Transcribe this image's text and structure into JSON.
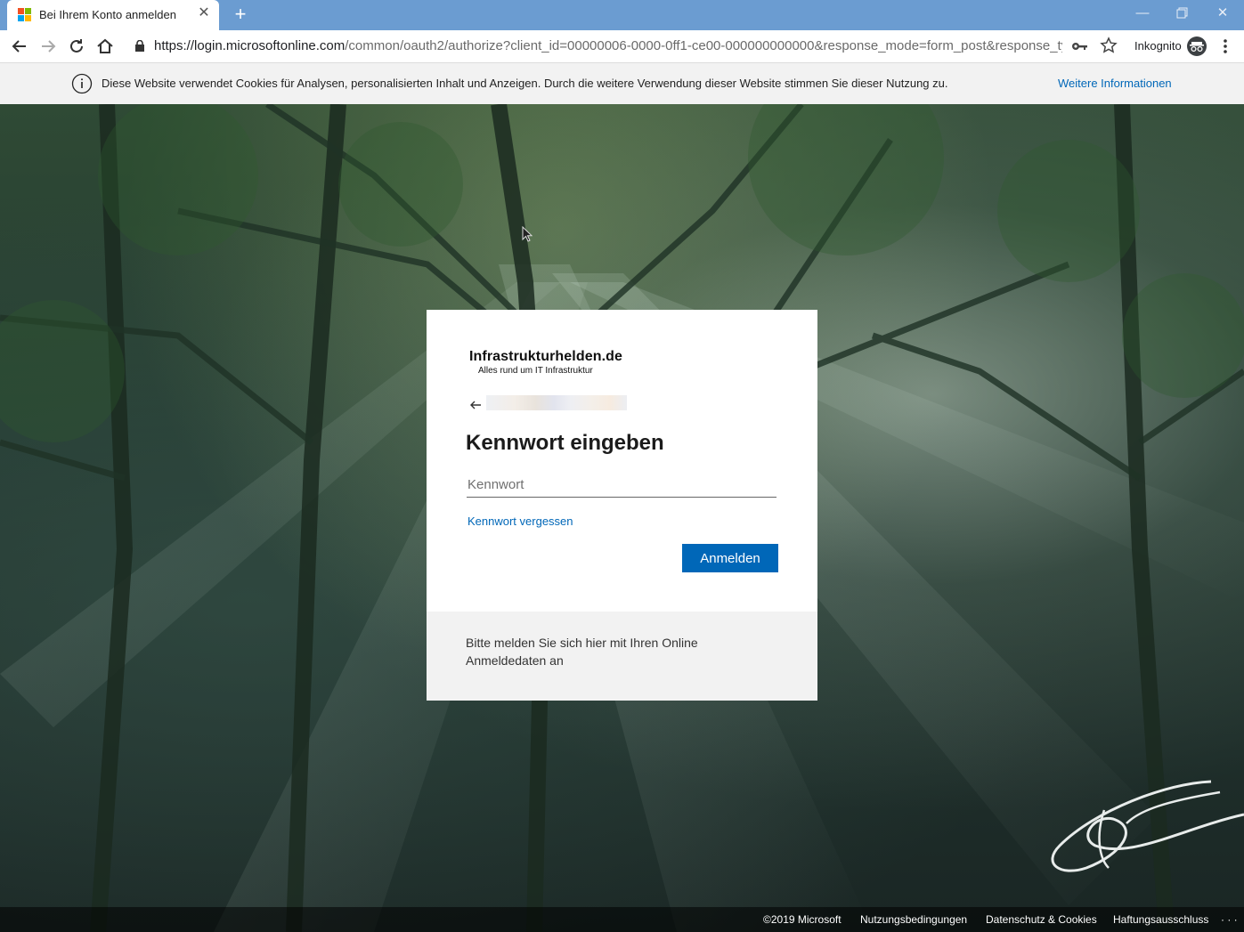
{
  "browser": {
    "tab_title": "Bei Ihrem Konto anmelden",
    "url_host": "https://login.microsoftonline.com",
    "url_path": "/common/oauth2/authorize?client_id=00000006-0000-0ff1-ce00-000000000000&response_mode=form_post&response_type=co...",
    "incognito_label": "Inkognito",
    "icons": [
      "back-icon",
      "forward-icon",
      "reload-icon",
      "home-icon",
      "lock-icon",
      "key-icon",
      "star-icon",
      "incognito-icon",
      "menu-icon"
    ]
  },
  "cookie_banner": {
    "text": "Diese Website verwendet Cookies für Analysen, personalisierten Inhalt und Anzeigen. Durch die weitere Verwendung dieser Website stimmen Sie dieser Nutzung zu.",
    "link": "Weitere Informationen"
  },
  "login": {
    "brand_name": "Infrastrukturhelden.de",
    "brand_tagline": "Alles rund um IT Infrastruktur",
    "title": "Kennwort eingeben",
    "password_placeholder": "Kennwort",
    "forgot_link": "Kennwort vergessen",
    "submit_label": "Anmelden",
    "footer_text": "Bitte melden Sie sich hier mit Ihren Online Anmeldedaten an"
  },
  "footer": {
    "copyright": "©2019 Microsoft",
    "terms": "Nutzungsbedingungen",
    "privacy": "Datenschutz & Cookies",
    "disclaimer": "Haftungsausschluss",
    "more": "· · ·"
  },
  "colors": {
    "accent": "#0067b8",
    "tabstrip": "#6b9cd1",
    "cookie_bar": "#f2f2f2"
  }
}
